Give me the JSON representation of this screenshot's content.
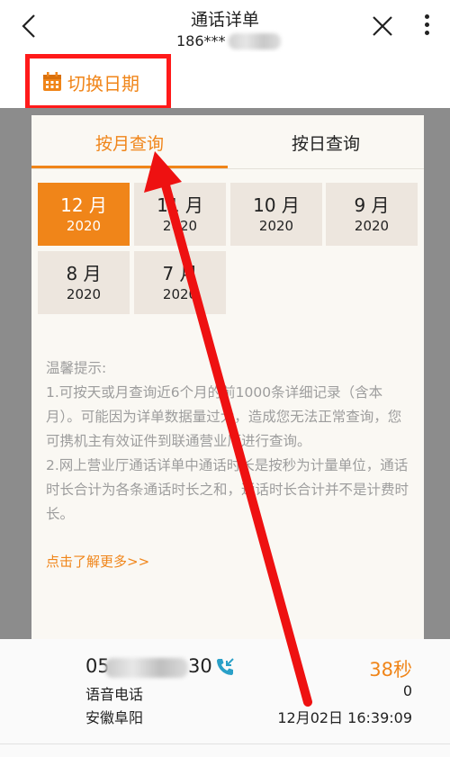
{
  "header": {
    "title": "通话详单",
    "subtitle": "186***"
  },
  "date_switch": {
    "label": "切换日期"
  },
  "modal": {
    "tabs": [
      "按月查询",
      "按日查询"
    ],
    "months": [
      {
        "month": "12 月",
        "year": "2020",
        "selected": true
      },
      {
        "month": "11 月",
        "year": "2020",
        "selected": false
      },
      {
        "month": "10 月",
        "year": "2020",
        "selected": false
      },
      {
        "month": "9 月",
        "year": "2020",
        "selected": false
      },
      {
        "month": "8 月",
        "year": "2020",
        "selected": false
      },
      {
        "month": "7 月",
        "year": "2020",
        "selected": false
      }
    ],
    "tips_title": "温馨提示:",
    "tips_1": "1.可按天或月查询近6个月的前1000条详细记录（含本月）。可能因为详单数据量过大，造成您无法正常查询，您可携机主有效证件到联通营业厅进行查询。",
    "tips_2": "2.网上营业厅通话详单中通话时长是按秒为计量单位，通话时长合计为各条通话时长之和，通话时长合计并不是计费时长。",
    "tips_link": "点击了解更多>>"
  },
  "record": {
    "number_start": "05",
    "number_end": "30",
    "type": "语音电话",
    "location": "安徽阜阳",
    "duration": "38秒",
    "fee": "0",
    "datetime": "12月02日  16:39:09"
  },
  "colors": {
    "accent": "#f08519",
    "highlight_box": "#ff1a1a",
    "overlay": "#8c8c8c",
    "modal_bg": "#faf8f3",
    "month_btn_bg": "#ede6de"
  },
  "icons": [
    "back-chevron-icon",
    "close-icon",
    "more-vertical-icon",
    "calendar-icon",
    "incoming-call-icon"
  ]
}
